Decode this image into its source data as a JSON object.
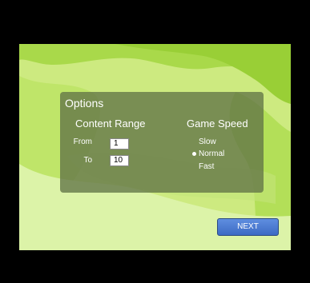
{
  "options": {
    "title": "Options",
    "content_range": {
      "heading": "Content Range",
      "from_label": "From",
      "from_value": "1",
      "to_label": "To",
      "to_value": "10"
    },
    "game_speed": {
      "heading": "Game Speed",
      "options": [
        "Slow",
        "Normal",
        "Fast"
      ],
      "selected": "Normal"
    }
  },
  "next_button": {
    "label": "NEXT"
  },
  "colors": {
    "background": "#000000",
    "stage_green": "#c9ea7a",
    "panel": "#627346",
    "button": "#4a79d1"
  }
}
